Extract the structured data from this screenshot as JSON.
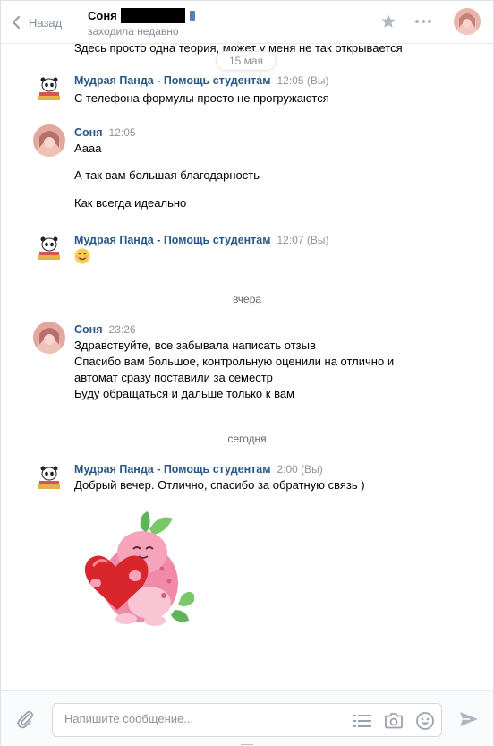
{
  "header": {
    "back_label": "Назад",
    "peer_name": "Соня",
    "peer_status": "заходила недавно"
  },
  "history": {
    "top_text": "Здесь просто одна теория, может у меня не так открывается",
    "date_pill": "15 мая",
    "groups": [
      {
        "author": "Мудрая Панда - Помощь студентам",
        "time": "12:05 (Вы)",
        "lines": [
          "С телефона формулы просто не прогружаются"
        ]
      },
      {
        "author": "Соня",
        "time": "12:05",
        "lines": [
          "Аааа",
          "А так вам большая благодарность",
          "Как всегда идеально"
        ]
      },
      {
        "author": "Мудрая Панда - Помощь студентам",
        "time": "12:07 (Вы)",
        "lines": []
      },
      {
        "author": "Соня",
        "time": "23:26",
        "lines": [
          "Здравствуйте, все забывала написать отзыв",
          "Спасибо вам большое, контрольную оценили на отлично и",
          "автомат сразу поставили за семестр",
          "Буду обращаться и дальше только к вам"
        ]
      },
      {
        "author": "Мудрая Панда - Помощь студентам",
        "time": "2:00 (Вы)",
        "lines": [
          "Добрый вечер. Отлично, спасибо за обратную связь )"
        ]
      }
    ],
    "separators": [
      "вчера",
      "сегодня"
    ]
  },
  "composer": {
    "placeholder": "Напишите сообщение..."
  },
  "colors": {
    "author_link": "#2a5885",
    "muted": "#939393",
    "border": "#e7e8ec",
    "icon": "#99a2ad"
  },
  "icons": [
    "chevron-left-icon",
    "star-icon",
    "more-icon",
    "attach-icon",
    "template-icon",
    "camera-icon",
    "emoji-icon",
    "send-icon"
  ]
}
